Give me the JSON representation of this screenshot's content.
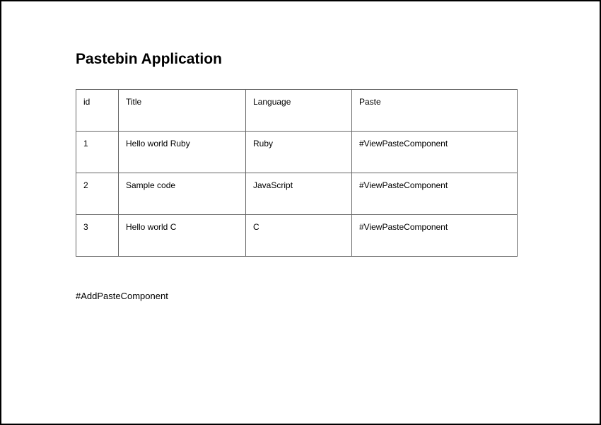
{
  "header": {
    "title": "Pastebin Application"
  },
  "table": {
    "columns": {
      "id": "id",
      "title": "Title",
      "language": "Language",
      "paste": "Paste"
    },
    "rows": [
      {
        "id": "1",
        "title": "Hello world Ruby",
        "language": "Ruby",
        "paste": "#ViewPasteComponent"
      },
      {
        "id": "2",
        "title": "Sample code",
        "language": "JavaScript",
        "paste": "#ViewPasteComponent"
      },
      {
        "id": "3",
        "title": "Hello world C",
        "language": "C",
        "paste": "#ViewPasteComponent"
      }
    ]
  },
  "footer": {
    "add_component": "#AddPasteComponent"
  }
}
